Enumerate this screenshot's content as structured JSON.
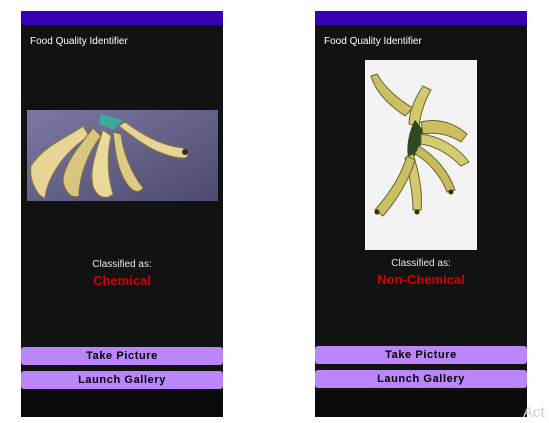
{
  "phones": [
    {
      "title": "Food Quality Identifier",
      "classified_label": "Classified as:",
      "result": "Chemical",
      "buttons": {
        "take": "Take Picture",
        "gallery": "Launch Gallery"
      }
    },
    {
      "title": "Food Quality Identifier",
      "classified_label": "Classified as:",
      "result": "Non-Chemical",
      "buttons": {
        "take": "Take Picture",
        "gallery": "Launch Gallery"
      }
    }
  ],
  "colors": {
    "status_bar": "#3700b3",
    "screen_bg": "#121212",
    "button_bg": "#bb86fc",
    "result_text": "#d50000"
  },
  "watermark": "Act"
}
